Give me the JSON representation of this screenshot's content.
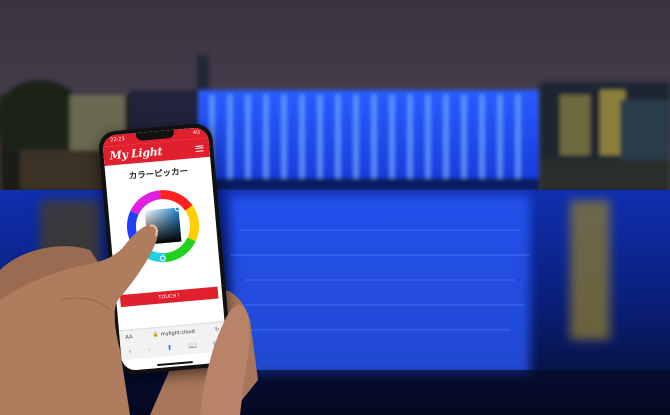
{
  "status_bar": {
    "time": "22:23",
    "signal": "4G"
  },
  "app": {
    "logo_text": "My Light",
    "menu_icon": "hamburger-menu-icon"
  },
  "page": {
    "title": "カラーピッカー"
  },
  "picker": {
    "selected_color": "#1c3550",
    "hue_ring": "rainbow"
  },
  "touch_button": {
    "label": "TOUCH !"
  },
  "browser": {
    "text_size_label": "AA",
    "url": "mylight.cloud",
    "lock_icon": "lock-icon",
    "tools": [
      "back-icon",
      "forward-icon",
      "share-icon",
      "bookmarks-icon",
      "tabs-icon"
    ]
  },
  "colors": {
    "brand_red": "#e0202c",
    "facade_blue": "#1a4dff",
    "water_blue": "#0b2a8a"
  }
}
